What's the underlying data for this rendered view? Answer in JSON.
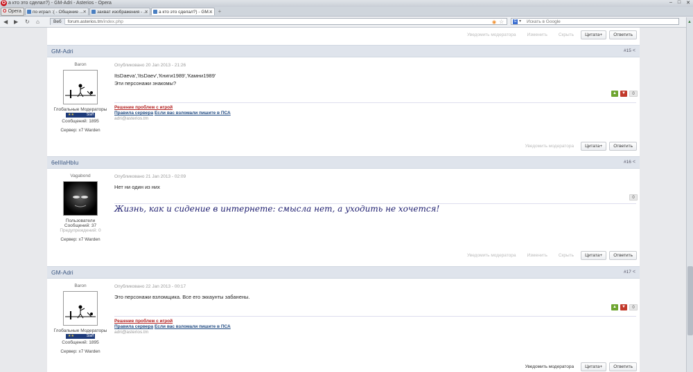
{
  "window": {
    "title": "а кто это сделал?) - GM-Adri - Asterios - Opera",
    "buttons": [
      "–",
      "□",
      "✕"
    ]
  },
  "tabs": [
    {
      "label": "Opera"
    },
    {
      "label": "по играл :( - Общение ..."
    },
    {
      "label": "захват изображения - ..."
    },
    {
      "label": "а кто это сделал?) - GM..."
    }
  ],
  "address": {
    "site_label": "Веб",
    "url_host": "forum.asterios.tm",
    "url_path": "/index.php",
    "search_placeholder": "Искать в Google"
  },
  "nav_icons": [
    "back-icon",
    "forward-icon",
    "reload-icon",
    "home-icon"
  ],
  "top_actions": {
    "notify": "Уведомить модератора",
    "edit": "Изменить",
    "hide": "Скрыть",
    "quote": "Цитата+",
    "reply": "Ответить"
  },
  "posts": [
    {
      "author": "GM-Adri",
      "number": "#15",
      "rank": "Baron",
      "group": "Глобальные Модераторы",
      "badge": "Staff",
      "badge_stars": "★★",
      "messages": "Сообщений: 1895",
      "server": "Сервер: x7 Warden",
      "date": "Опубликовано 20 Jan 2013 - 21:26",
      "lines": [
        "ItsDaeva','ItsDaev','Книги1989','Камни1989'",
        "Эти персонажи знакомы?"
      ],
      "rep": "0",
      "sig_red": "Решение проблем с игрой",
      "sig_blue1": "Правила сервера",
      "sig_blue2": "Если вас взломали пишите в ПСА",
      "sig_mail": "adri@asterios.tm",
      "actions": {
        "notify": "Уведомить модератора",
        "quote": "Цитата+",
        "reply": "Ответить"
      }
    },
    {
      "author": "6eIIIaHbIu",
      "number": "#16",
      "rank": "Vagabond",
      "group": "Пользователи",
      "messages": "Сообщений: 37",
      "warnings": "Предупреждений: 0",
      "server": "Сервер: x7 Warden",
      "date": "Опубликовано 21 Jan 2013 - 02:09",
      "lines": [
        "Нет ни один из них"
      ],
      "rep": "0",
      "quote": "Жизнь, как и сидение в интернете: смысла нет, а уходить не хочется!",
      "actions": {
        "notify": "Уведомить модератора",
        "edit": "Изменить",
        "hide": "Скрыть",
        "quote": "Цитата+",
        "reply": "Ответить"
      }
    },
    {
      "author": "GM-Adri",
      "number": "#17",
      "rank": "Baron",
      "group": "Глобальные Модераторы",
      "badge": "Staff",
      "badge_stars": "★★",
      "messages": "Сообщений: 1895",
      "server": "Сервер: x7 Warden",
      "date": "Опубликовано 22 Jan 2013 - 00:17",
      "lines": [
        "Это персонажи взломщика. Все его эккаунты забанены."
      ],
      "rep": "0",
      "sig_red": "Решение проблем с игрой",
      "sig_blue1": "Правила сервера",
      "sig_blue2": "Если вас взломали пишите в ПСА",
      "sig_mail": "adri@asterios.tm",
      "actions": {
        "notify": "Уведомить модератора",
        "quote": "Цитата+",
        "reply": "Ответить"
      }
    }
  ]
}
